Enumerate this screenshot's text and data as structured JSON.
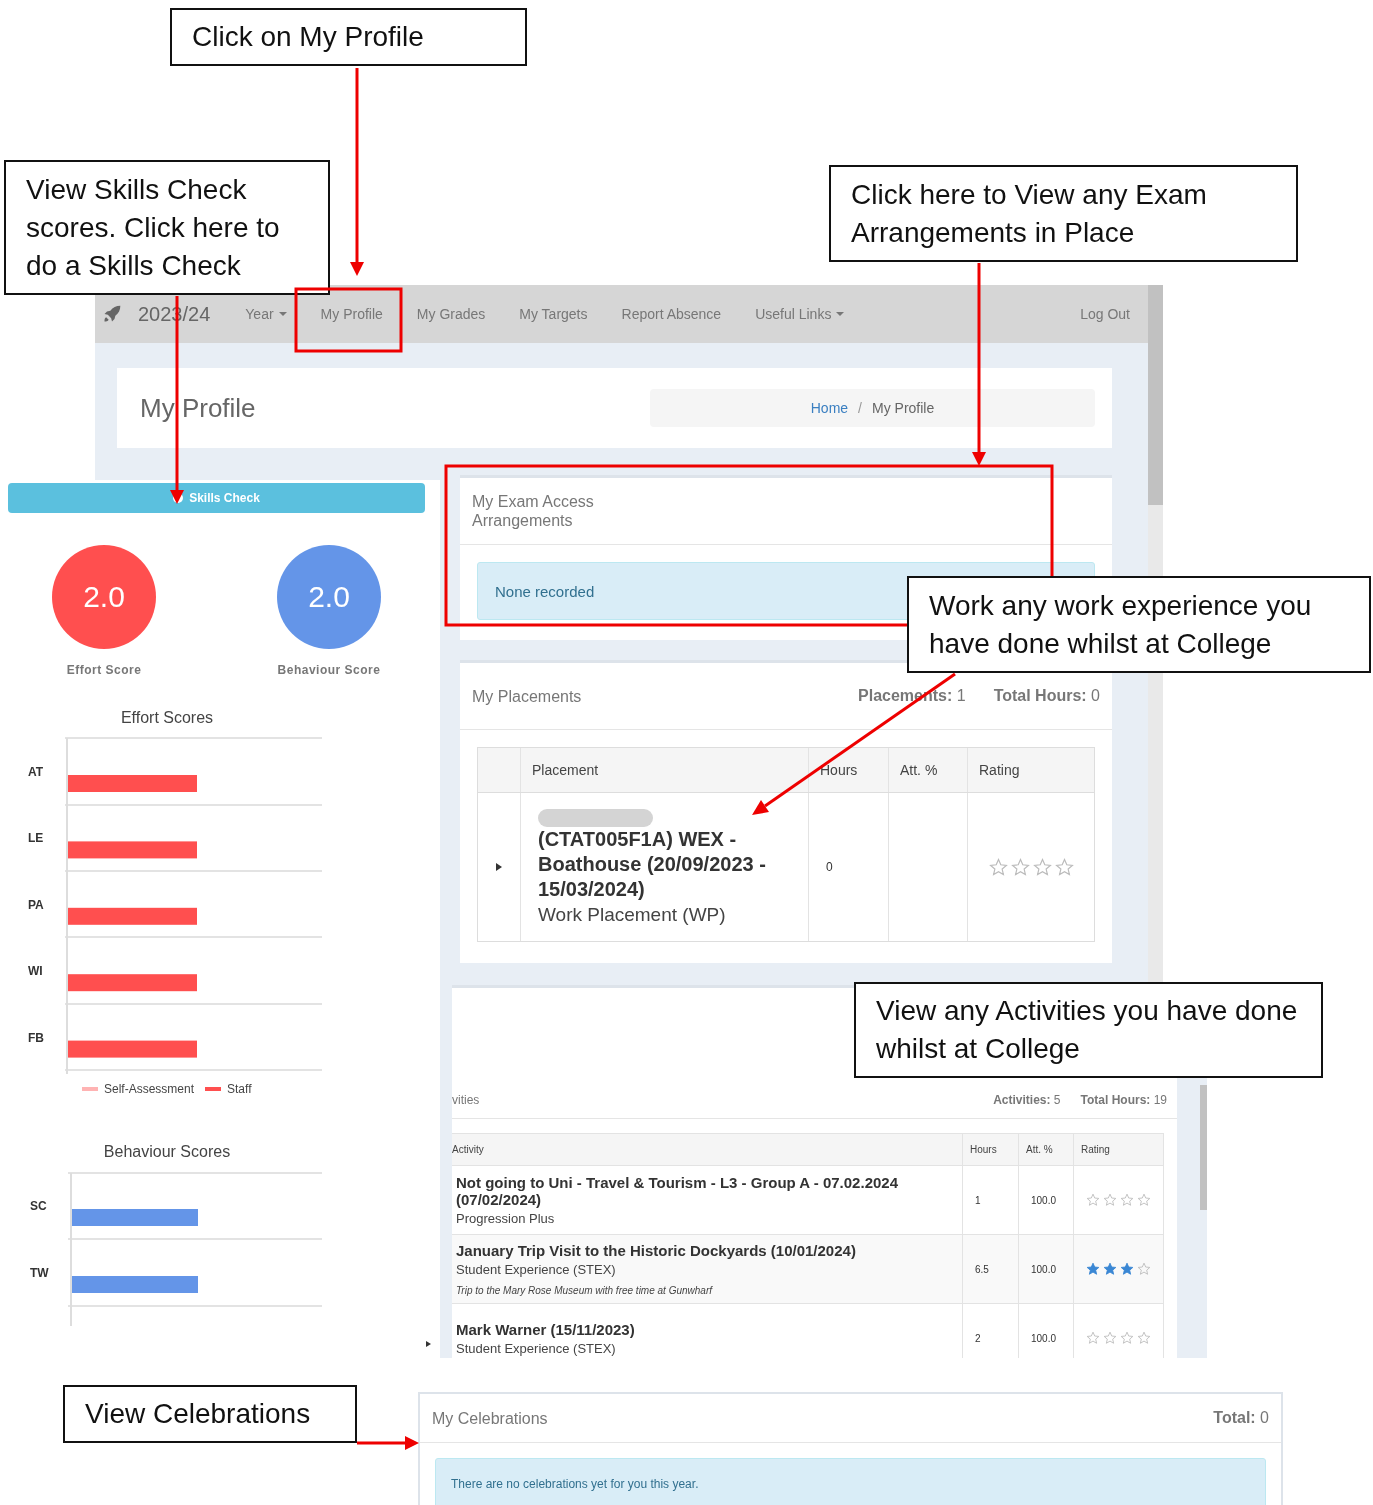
{
  "callouts": [
    {
      "text": "Click on My Profile"
    },
    {
      "text": "View Skills Check scores. Click here to do a Skills Check"
    },
    {
      "text": "Click here to View any Exam Arrangements in Place"
    },
    {
      "text": "Work any work experience you have done whilst at College"
    },
    {
      "text": "View any Activities you have done whilst at College"
    },
    {
      "text": "View Celebrations"
    }
  ],
  "nav": {
    "year": "2023/24",
    "items": [
      {
        "label": "Year",
        "dropdown": true
      },
      {
        "label": "My Profile",
        "dropdown": false
      },
      {
        "label": "My Grades",
        "dropdown": false
      },
      {
        "label": "My Targets",
        "dropdown": false
      },
      {
        "label": "Report Absence",
        "dropdown": false
      },
      {
        "label": "Useful Links",
        "dropdown": true
      }
    ],
    "logout": "Log Out"
  },
  "page_header": {
    "title": "My Profile",
    "separator": "/",
    "breadcrumb": [
      {
        "label": "Home",
        "link": true
      },
      {
        "label": "My Profile",
        "link": false
      }
    ]
  },
  "skills": {
    "button": "Skills Check",
    "scores": [
      {
        "value": "2.0",
        "label": "Effort Score",
        "color": "#ff4f4f"
      },
      {
        "value": "2.0",
        "label": "Behaviour Score",
        "color": "#6495e8"
      }
    ],
    "effort_chart": {
      "title": "Effort Scores",
      "categories": [
        "AT",
        "LE",
        "PA",
        "WI",
        "FB"
      ],
      "legend": [
        {
          "name": "Self-Assessment",
          "color": "#ffb3b3"
        },
        {
          "name": "Staff",
          "color": "#ff4f4f"
        }
      ]
    },
    "behaviour_chart": {
      "title": "Behaviour Scores",
      "categories": [
        "SC",
        "TW"
      ]
    }
  },
  "exam": {
    "title": "My Exam Access Arrangements",
    "message": "None recorded"
  },
  "placements": {
    "title": "My Placements",
    "stats": [
      "**Placements:** 1",
      "**Total Hours:** 0"
    ],
    "columns": [
      "Placement",
      "Hours",
      "Att. %",
      "Rating"
    ],
    "rows": [
      {
        "title": "(CTAT005F1A) WEX - Boathouse (20/09/2023 - 15/03/2024)",
        "subtitle": "Work Placement (WP)",
        "hours": "0",
        "stars": 0
      }
    ]
  },
  "activities": {
    "title": "vities",
    "stats": [
      "**Activities:** 5",
      "**Total Hours:** 19"
    ],
    "columns": [
      "Activity",
      "Hours",
      "Att. %",
      "Rating"
    ],
    "rows": [
      {
        "title": "Not going to Uni - Travel & Tourism - L3 - Group A - 07.02.2024 (07/02/2024)",
        "subtitle": "Progression Plus",
        "hours": "1",
        "attendance": "100.0",
        "stars": 0
      },
      {
        "title": "January Trip Visit to the Historic Dockyards (10/01/2024)",
        "subtitle": "Student Experience (STEX)",
        "note": "Trip to the Mary Rose Museum with free time at Gunwharf",
        "hours": "6.5",
        "attendance": "100.0",
        "stars": 3
      },
      {
        "title": "Mark Warner (15/11/2023)",
        "subtitle": "Student Experience (STEX)",
        "hours": "2",
        "attendance": "100.0",
        "stars": 0
      }
    ]
  },
  "celebrations": {
    "title": "My Celebrations",
    "stats": [
      "**Total:** 0"
    ],
    "message": "There are no celebrations yet for you this year."
  }
}
